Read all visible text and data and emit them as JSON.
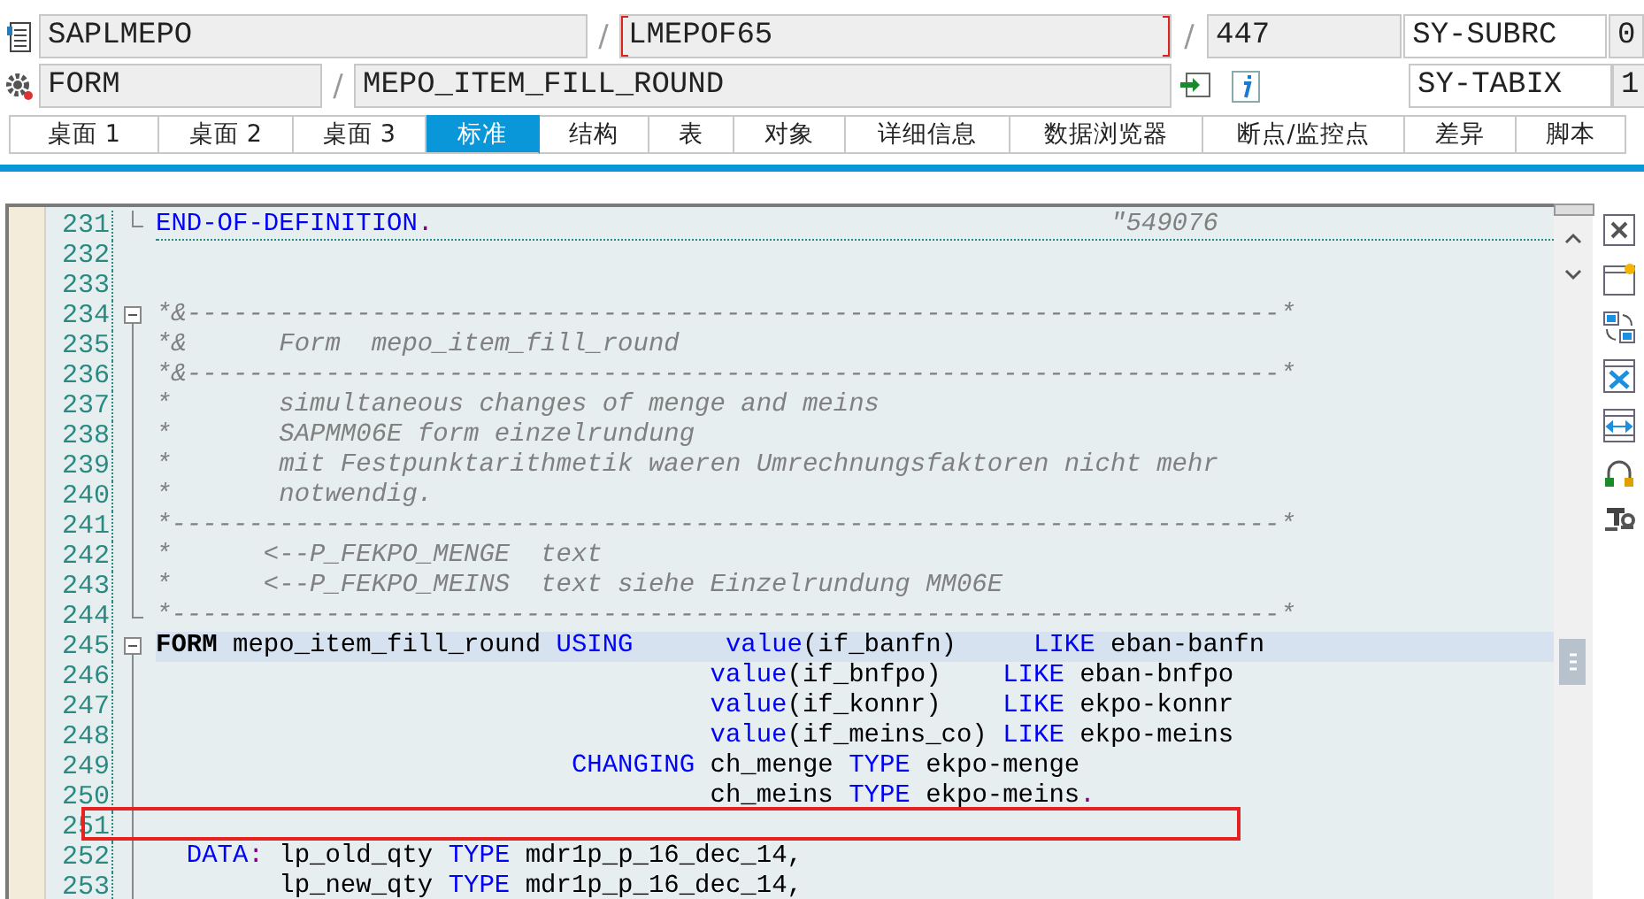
{
  "header": {
    "program": "SAPLMEPO",
    "separators": [
      "/",
      "/",
      "/"
    ],
    "include": "LMEPOF65",
    "line": "447",
    "event_type": "FORM",
    "event_name": "MEPO_ITEM_FILL_ROUND",
    "vars": [
      {
        "name": "SY-SUBRC",
        "value": "0"
      },
      {
        "name": "SY-TABIX",
        "value": "1"
      }
    ]
  },
  "tabs": [
    {
      "label": "桌面 1",
      "selected": false
    },
    {
      "label": "桌面 2",
      "selected": false
    },
    {
      "label": "桌面 3",
      "selected": false
    },
    {
      "label": "标准",
      "selected": true
    },
    {
      "label": "结构",
      "selected": false
    },
    {
      "label": "表",
      "selected": false
    },
    {
      "label": "对象",
      "selected": false
    },
    {
      "label": "详细信息",
      "selected": false
    },
    {
      "label": "数据浏览器",
      "selected": false
    },
    {
      "label": "断点/监控点",
      "selected": false
    },
    {
      "label": "差异",
      "selected": false
    },
    {
      "label": "脚本",
      "selected": false
    }
  ],
  "code_lines": [
    {
      "number": "231",
      "fold_end": true,
      "separator_below": true,
      "tokens": [
        {
          "kind": "keyword",
          "text": "END-OF-DEFINITION"
        },
        {
          "kind": "punct",
          "text": "."
        },
        {
          "kind": "comment",
          "text": "                                            \"549076"
        }
      ]
    },
    {
      "number": "232"
    },
    {
      "number": "233"
    },
    {
      "number": "234",
      "fold_start": true,
      "tokens": [
        {
          "kind": "comment",
          "text": "*&-----------------------------------------------------------------------*"
        }
      ]
    },
    {
      "number": "235",
      "in_fold": true,
      "tokens": [
        {
          "kind": "comment",
          "text": "*&      Form  mepo_item_fill_round"
        }
      ]
    },
    {
      "number": "236",
      "in_fold": true,
      "tokens": [
        {
          "kind": "comment",
          "text": "*&-----------------------------------------------------------------------*"
        }
      ]
    },
    {
      "number": "237",
      "in_fold": true,
      "tokens": [
        {
          "kind": "comment",
          "text": "*       simultaneous changes of menge and meins"
        }
      ]
    },
    {
      "number": "238",
      "in_fold": true,
      "tokens": [
        {
          "kind": "comment",
          "text": "*       SAPMM06E form einzelrundung"
        }
      ]
    },
    {
      "number": "239",
      "in_fold": true,
      "tokens": [
        {
          "kind": "comment",
          "text": "*       mit Festpunktarithmetik waeren Umrechnungsfaktoren nicht mehr"
        }
      ]
    },
    {
      "number": "240",
      "in_fold": true,
      "tokens": [
        {
          "kind": "comment",
          "text": "*       notwendig."
        }
      ]
    },
    {
      "number": "241",
      "in_fold": true,
      "tokens": [
        {
          "kind": "comment",
          "text": "*------------------------------------------------------------------------*"
        }
      ]
    },
    {
      "number": "242",
      "in_fold": true,
      "tokens": [
        {
          "kind": "comment",
          "text": "*      <--P_FEKPO_MENGE  text"
        }
      ]
    },
    {
      "number": "243",
      "in_fold": true,
      "tokens": [
        {
          "kind": "comment",
          "text": "*      <--P_FEKPO_MEINS  text siehe Einzelrundung MM06E"
        }
      ]
    },
    {
      "number": "244",
      "fold_end": true,
      "tokens": [
        {
          "kind": "comment",
          "text": "*------------------------------------------------------------------------*"
        }
      ]
    },
    {
      "number": "245",
      "fold_start": true,
      "highlighted": true,
      "tokens": [
        {
          "kind": "bold",
          "text": "FORM"
        },
        {
          "kind": "plain",
          "text": " mepo_item_fill_round "
        },
        {
          "kind": "keyword",
          "text": "USING"
        },
        {
          "kind": "keyword",
          "text": "      value"
        },
        {
          "kind": "plain",
          "text": "(if_banfn)     "
        },
        {
          "kind": "keyword",
          "text": "LIKE"
        },
        {
          "kind": "plain",
          "text": " eban-banfn"
        }
      ]
    },
    {
      "number": "246",
      "in_fold": true,
      "tokens": [
        {
          "kind": "keyword",
          "text": "                                    value"
        },
        {
          "kind": "plain",
          "text": "(if_bnfpo)    "
        },
        {
          "kind": "keyword",
          "text": "LIKE"
        },
        {
          "kind": "plain",
          "text": " eban-bnfpo"
        }
      ]
    },
    {
      "number": "247",
      "in_fold": true,
      "tokens": [
        {
          "kind": "keyword",
          "text": "                                    value"
        },
        {
          "kind": "plain",
          "text": "(if_konnr)    "
        },
        {
          "kind": "keyword",
          "text": "LIKE"
        },
        {
          "kind": "plain",
          "text": " ekpo-konnr"
        }
      ]
    },
    {
      "number": "248",
      "in_fold": true,
      "tokens": [
        {
          "kind": "keyword",
          "text": "                                    value"
        },
        {
          "kind": "plain",
          "text": "(if_meins_co) "
        },
        {
          "kind": "keyword",
          "text": "LIKE"
        },
        {
          "kind": "plain",
          "text": " ekpo-meins"
        }
      ]
    },
    {
      "number": "249",
      "in_fold": true,
      "tokens": [
        {
          "kind": "keyword",
          "text": "                           CHANGING"
        },
        {
          "kind": "plain",
          "text": " ch_menge "
        },
        {
          "kind": "keyword",
          "text": "TYPE"
        },
        {
          "kind": "plain",
          "text": " ekpo-menge"
        }
      ]
    },
    {
      "number": "250",
      "in_fold": true,
      "tokens": [
        {
          "kind": "plain",
          "text": "                                    ch_meins "
        },
        {
          "kind": "keyword",
          "text": "TYPE"
        },
        {
          "kind": "plain",
          "text": " ekpo-meins"
        },
        {
          "kind": "punct",
          "text": "."
        }
      ]
    },
    {
      "number": "251",
      "in_fold": true,
      "boxed": true
    },
    {
      "number": "252",
      "in_fold": true,
      "tokens": [
        {
          "kind": "keyword",
          "text": "  DATA"
        },
        {
          "kind": "punct",
          "text": ":"
        },
        {
          "kind": "plain",
          "text": " lp_old_qty "
        },
        {
          "kind": "keyword",
          "text": "TYPE"
        },
        {
          "kind": "plain",
          "text": " mdr1p_p_16_dec_14,"
        }
      ]
    },
    {
      "number": "253",
      "in_fold": true,
      "tokens": [
        {
          "kind": "plain",
          "text": "        lp_new_qty "
        },
        {
          "kind": "keyword",
          "text": "TYPE"
        },
        {
          "kind": "plain",
          "text": " mdr1p_p_16_dec_14,"
        }
      ]
    }
  ]
}
